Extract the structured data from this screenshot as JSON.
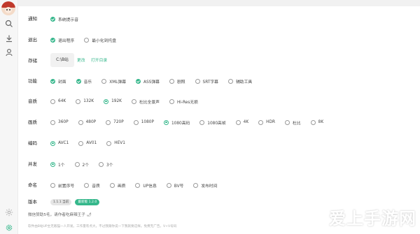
{
  "colors": {
    "accent": "#35b78b",
    "sidebar_bg": "#f6f6f6"
  },
  "sidebar": {
    "icons": [
      "avatar",
      "search-icon",
      "download-icon",
      "user-icon",
      "sun-icon",
      "settings-icon"
    ]
  },
  "settings": {
    "notify": {
      "label": "通知",
      "options": [
        {
          "text": "系统提示音",
          "checked": true
        }
      ]
    },
    "exit": {
      "label": "退出",
      "options": [
        {
          "text": "退出程序",
          "selected": true
        },
        {
          "text": "最小化到托盘",
          "selected": false
        }
      ]
    },
    "storage": {
      "label": "存储",
      "path": "C:\\B站",
      "change": "更改",
      "open": "打开目录"
    },
    "features": {
      "label": "功能",
      "options": [
        {
          "text": "封面",
          "checked": true
        },
        {
          "text": "音乐",
          "checked": true
        },
        {
          "text": "XML弹幕",
          "checked": false
        },
        {
          "text": "ASS弹幕",
          "checked": true
        },
        {
          "text": "剧照",
          "checked": false
        },
        {
          "text": "SRT字幕",
          "checked": false
        },
        {
          "text": "辅助工具",
          "checked": false
        }
      ]
    },
    "audio": {
      "label": "音质",
      "options": [
        {
          "text": "64K",
          "selected": false
        },
        {
          "text": "132K",
          "selected": false
        },
        {
          "text": "192K",
          "selected": true
        },
        {
          "text": "杜比全景声",
          "selected": false
        },
        {
          "text": "Hi-Res无损",
          "selected": false
        }
      ]
    },
    "video": {
      "label": "画质",
      "options": [
        {
          "text": "360P",
          "selected": false
        },
        {
          "text": "480P",
          "selected": false
        },
        {
          "text": "720P",
          "selected": false
        },
        {
          "text": "1080P",
          "selected": false
        },
        {
          "text": "1080高码",
          "selected": true
        },
        {
          "text": "1080高帧",
          "selected": false
        },
        {
          "text": "4K",
          "selected": false
        },
        {
          "text": "HDR",
          "selected": false
        },
        {
          "text": "杜比",
          "selected": false
        },
        {
          "text": "8K",
          "selected": false
        }
      ]
    },
    "codec": {
      "label": "编码",
      "options": [
        {
          "text": "AVC1",
          "selected": true
        },
        {
          "text": "AV01",
          "selected": false
        },
        {
          "text": "HEV1",
          "selected": false
        }
      ]
    },
    "concurrency": {
      "label": "并发",
      "options": [
        {
          "text": "1个",
          "selected": true
        },
        {
          "text": "2个",
          "selected": false
        },
        {
          "text": "3个",
          "selected": false
        }
      ]
    },
    "naming": {
      "label": "命名",
      "options": [
        {
          "text": "前置序号",
          "selected": false
        },
        {
          "text": "音质",
          "selected": false
        },
        {
          "text": "画质",
          "selected": false
        },
        {
          "text": "UP信息",
          "selected": false
        },
        {
          "text": "BV号",
          "selected": false
        },
        {
          "text": "发布时间",
          "selected": false
        }
      ]
    },
    "version": {
      "label": "版本",
      "current": "1.1.1 当前",
      "latest": "最新版 1.2.0"
    }
  },
  "footer": {
    "sponsor": "微信赞助5毛，请作者吃麻辣王子 🌶",
    "notice": "软件由B站UP主无敌猫一人开发。工作量有点大。不过我跟你说一下我就要这样。免费无广告。V+V号码"
  },
  "watermark": {
    "text": "爱上手游网"
  }
}
